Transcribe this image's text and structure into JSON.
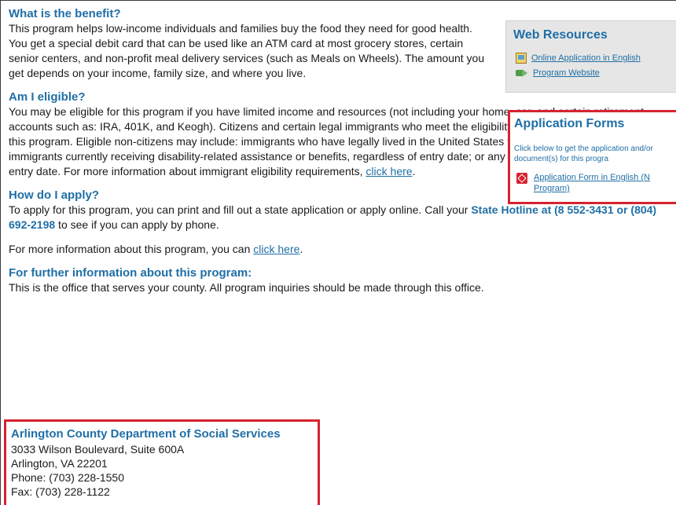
{
  "content": {
    "benefit": {
      "title": "What is the benefit?",
      "text": "This program helps low-income individuals and families buy the food they need for good health. You get a special debit card that can be used like an ATM card at most grocery stores, certain senior centers, and non-profit meal delivery services (such as Meals on Wheels). The amount you get depends on your income, family size, and where you live."
    },
    "eligible": {
      "title": "Am I eligible?",
      "text_part1": "You may be eligible for this program if you have limited income and resources (not including your home, car, and certain retirement accounts such as: IRA, 401K, and Keogh). Citizens and certain legal immigrants who meet the eligibility guidelines, may be eligible for this program. Eligible non-citizens may include: immigrants who have legally lived in the United States for at least 5 years or more; immigrants currently receiving disability-related assistance or benefits, regardless of entry date; or any immigrant child, regardless of entry date. For more information about immigrant eligibility requirements, ",
      "link_label": "click here",
      "text_part2": "."
    },
    "apply": {
      "title": "How do I apply?",
      "text_part1": "To apply for this program, you can print and fill out a state application or apply online. Call your ",
      "hotline": "State Hotline at (8 552-3431 or (804) 692-2198",
      "text_part2": " to see if you can apply by phone.",
      "more_info_prefix": "For more information about this program, you can ",
      "more_info_link": "click here",
      "more_info_suffix": "."
    },
    "further": {
      "title": "For further information about this program:",
      "text": "This is the office that serves your county. All program inquiries should be made through this office."
    },
    "office": {
      "name": "Arlington County Department of Social Services",
      "address1": "3033 Wilson Boulevard, Suite 600A",
      "address2": "Arlington, VA 22201",
      "phone": "Phone: (703) 228-1550",
      "fax": "Fax: (703) 228-1122"
    }
  },
  "rail": {
    "web_resources": {
      "title": "Web Resources",
      "items": [
        {
          "icon": "document-icon",
          "label": "Online Application in English"
        },
        {
          "icon": "website-icon",
          "label": "Program Website"
        }
      ]
    },
    "application_forms": {
      "title": "Application Forms",
      "description": "Click below to get the application and/or document(s) for this progra",
      "item": {
        "icon": "pdf-icon",
        "label": "Application Form in English (N Program)"
      }
    }
  },
  "colors": {
    "accent": "#1f6fa6",
    "highlight_border": "#d6232f"
  }
}
